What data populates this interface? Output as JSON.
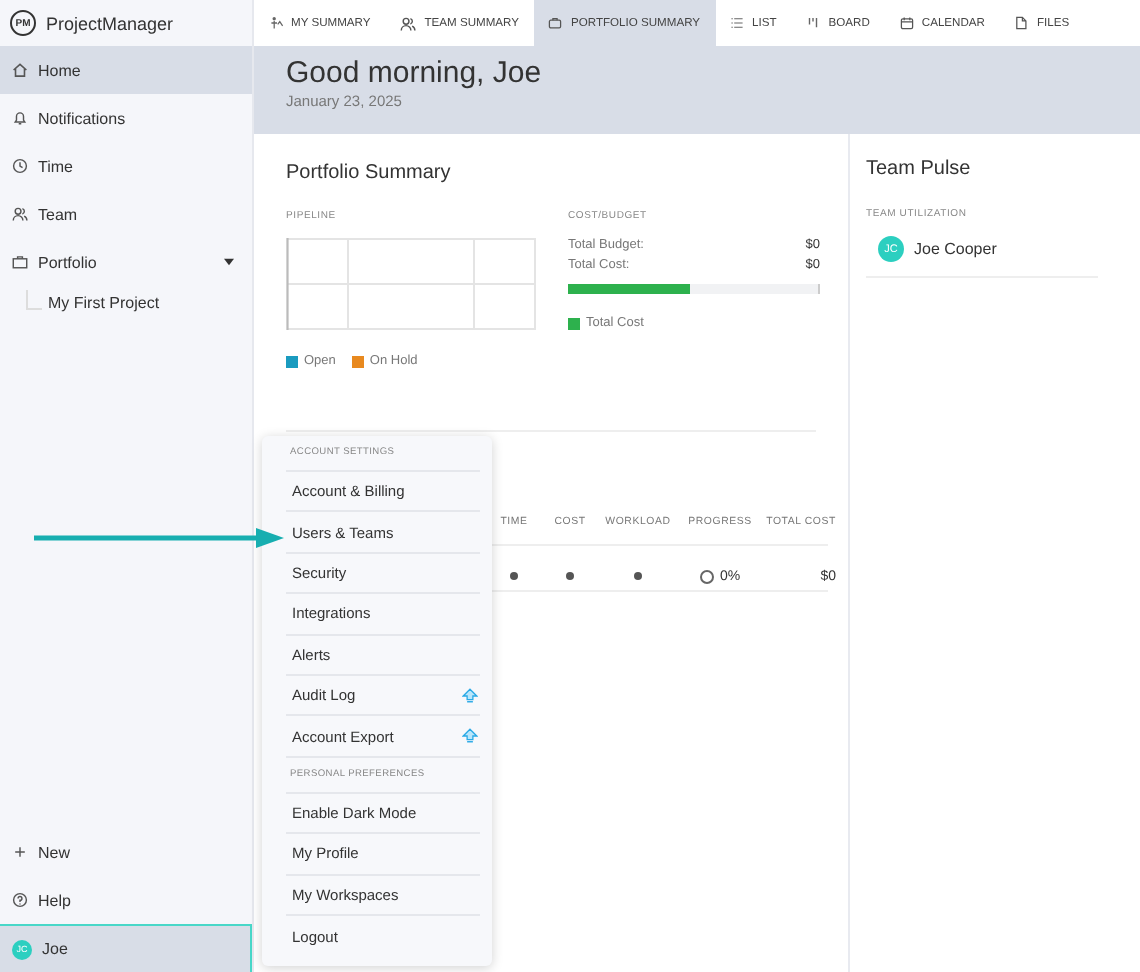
{
  "app": {
    "name": "ProjectManager",
    "logo": "PM"
  },
  "tabs": [
    {
      "label": "MY SUMMARY",
      "selected": false
    },
    {
      "label": "TEAM SUMMARY",
      "selected": false
    },
    {
      "label": "PORTFOLIO SUMMARY",
      "selected": true
    },
    {
      "label": "LIST",
      "selected": false
    },
    {
      "label": "BOARD",
      "selected": false
    },
    {
      "label": "CALENDAR",
      "selected": false
    },
    {
      "label": "FILES",
      "selected": false
    }
  ],
  "sidebar": {
    "items": [
      {
        "label": "Home",
        "selected": true
      },
      {
        "label": "Notifications",
        "selected": false
      },
      {
        "label": "Time",
        "selected": false
      },
      {
        "label": "Team",
        "selected": false
      },
      {
        "label": "Portfolio",
        "selected": false,
        "expanded": true,
        "children": [
          {
            "label": "My First Project"
          }
        ]
      }
    ],
    "bottom": [
      {
        "label": "New",
        "selected": false
      },
      {
        "label": "Help",
        "selected": false
      }
    ],
    "user": {
      "label": "Joe",
      "initials": "JC",
      "selected": true
    }
  },
  "header": {
    "greeting": "Good morning, Joe",
    "date": "January 23, 2025"
  },
  "portfolio": {
    "title": "Portfolio Summary",
    "pipeline": {
      "label": "PIPELINE",
      "legend": [
        {
          "label": "Open",
          "color": "#1a9bbf"
        },
        {
          "label": "On Hold",
          "color": "#e8891f"
        }
      ]
    },
    "cost_budget": {
      "label": "COST/BUDGET",
      "rows": [
        {
          "label": "Total Budget:",
          "value": "$0"
        },
        {
          "label": "Total Cost:",
          "value": "$0"
        }
      ],
      "level": 0.49,
      "legend": "Total Cost"
    },
    "table": {
      "columns": [
        "TIME",
        "COST",
        "WORKLOAD",
        "PROGRESS",
        "TOTAL COST"
      ],
      "row": {
        "progress": "0%",
        "total_cost": "$0"
      }
    }
  },
  "team_pulse": {
    "title": "Team Pulse",
    "label": "TEAM UTILIZATION",
    "members": [
      {
        "initials": "JC",
        "name": "Joe Cooper"
      }
    ]
  },
  "menu": {
    "sections": [
      {
        "heading": "ACCOUNT SETTINGS",
        "items": [
          {
            "label": "Account & Billing",
            "upgrade": false
          },
          {
            "label": "Users & Teams",
            "upgrade": false
          },
          {
            "label": "Security",
            "upgrade": false
          },
          {
            "label": "Integrations",
            "upgrade": false
          },
          {
            "label": "Alerts",
            "upgrade": false
          },
          {
            "label": "Audit Log",
            "upgrade": true
          },
          {
            "label": "Account Export",
            "upgrade": true
          }
        ]
      },
      {
        "heading": "PERSONAL PREFERENCES",
        "items": [
          {
            "label": "Enable Dark Mode",
            "upgrade": false
          },
          {
            "label": "My Profile",
            "upgrade": false
          },
          {
            "label": "My Workspaces",
            "upgrade": false
          },
          {
            "label": "Logout",
            "upgrade": false
          }
        ]
      }
    ]
  }
}
